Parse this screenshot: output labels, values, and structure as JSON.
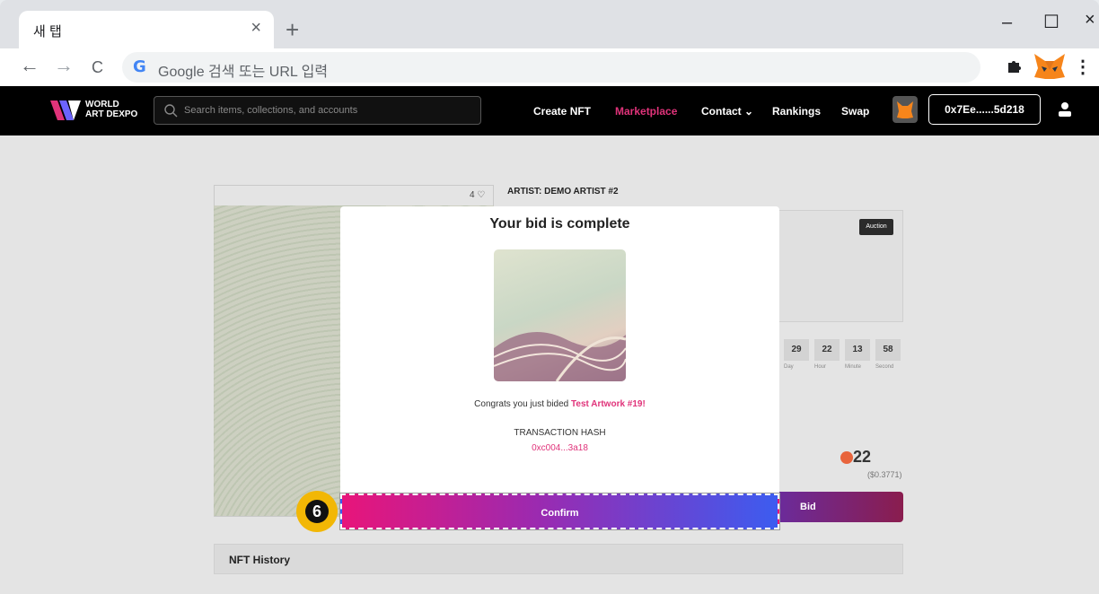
{
  "browser": {
    "tab_title": "새 탭",
    "tab_close": "×",
    "new_tab": "+",
    "minimize": "–",
    "maximize": "☐",
    "close": "×",
    "back": "←",
    "forward": "→",
    "reload": "C",
    "omnibox_placeholder": "Google 검색 또는 URL 입력",
    "google_logo": "G",
    "menu": "⋮"
  },
  "site": {
    "logo_line1": "WORLD",
    "logo_line2": "ART DEXPO",
    "search_placeholder": "Search items, collections, and accounts",
    "nav": {
      "create": "Create NFT",
      "marketplace": "Marketplace",
      "contact": "Contact ⌄",
      "rankings": "Rankings",
      "swap": "Swap"
    },
    "wallet": "0x7Ee......5d218"
  },
  "detail": {
    "likes": "4 ♡",
    "artist": "ARTIST: DEMO ARTIST #2",
    "auction_badge": "Auction",
    "timer": [
      {
        "value": "29",
        "label": "Day"
      },
      {
        "value": "22",
        "label": "Hour"
      },
      {
        "value": "13",
        "label": "Minute"
      },
      {
        "value": "58",
        "label": "Second"
      }
    ],
    "price": "22",
    "usd": "($0.3771)",
    "bid_label": "Bid",
    "history_title": "NFT History"
  },
  "modal": {
    "title": "Your bid is complete",
    "congrats_prefix": "Congrats you just bided ",
    "artwork_name": "Test Artwork #19!",
    "hash_label": "TRANSACTION HASH",
    "hash_value": "0xc004...3a18",
    "confirm_label": "Confirm"
  },
  "annotation": {
    "step_number": "6"
  },
  "colors": {
    "accent_pink": "#e0337a",
    "step_badge": "#f2b705"
  }
}
